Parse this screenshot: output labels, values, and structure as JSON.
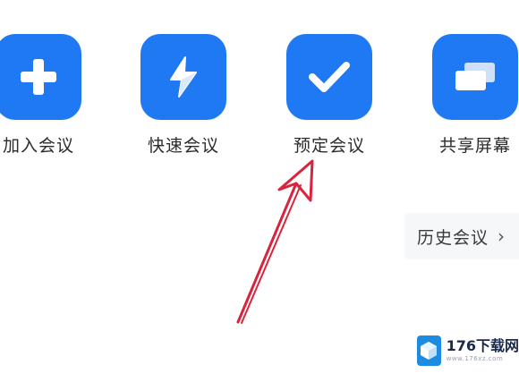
{
  "actions": {
    "join": {
      "label": "加入会议",
      "icon": "plus-icon"
    },
    "quick": {
      "label": "快速会议",
      "icon": "lightning-icon"
    },
    "schedule": {
      "label": "预定会议",
      "icon": "checkmark-icon"
    },
    "share": {
      "label": "共享屏幕",
      "icon": "screen-share-icon"
    }
  },
  "history": {
    "label": "历史会议",
    "chevron": "›",
    "icon": "chevron-right-icon"
  },
  "annotation": {
    "icon": "red-arrow-annotation",
    "color": "#d8243c"
  },
  "watermark": {
    "title": "176下载网",
    "subtitle": "www.176xz.com"
  },
  "colors": {
    "accent": "#1f79f3",
    "background": "#ffffff"
  }
}
